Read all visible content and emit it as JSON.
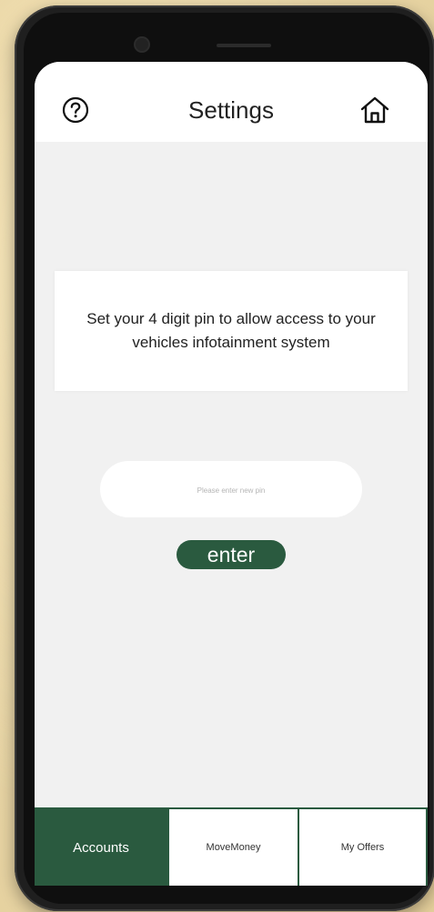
{
  "header": {
    "title": "Settings",
    "help_icon": "question-circle-icon",
    "home_icon": "home-icon"
  },
  "info_card": {
    "message": "Set your 4 digit pin to allow access to your vehicles infotainment system"
  },
  "pin_form": {
    "value": "",
    "placeholder": "Please enter new pin",
    "submit_label": "enter"
  },
  "bottom_nav": {
    "tabs": [
      {
        "label": "Accounts",
        "active": true
      },
      {
        "label": "MoveMoney",
        "active": false
      },
      {
        "label": "My Offers",
        "active": false
      }
    ]
  },
  "colors": {
    "accent": "#2a5a3f",
    "screen_background": "#f1f1f1",
    "card_background": "#ffffff"
  }
}
